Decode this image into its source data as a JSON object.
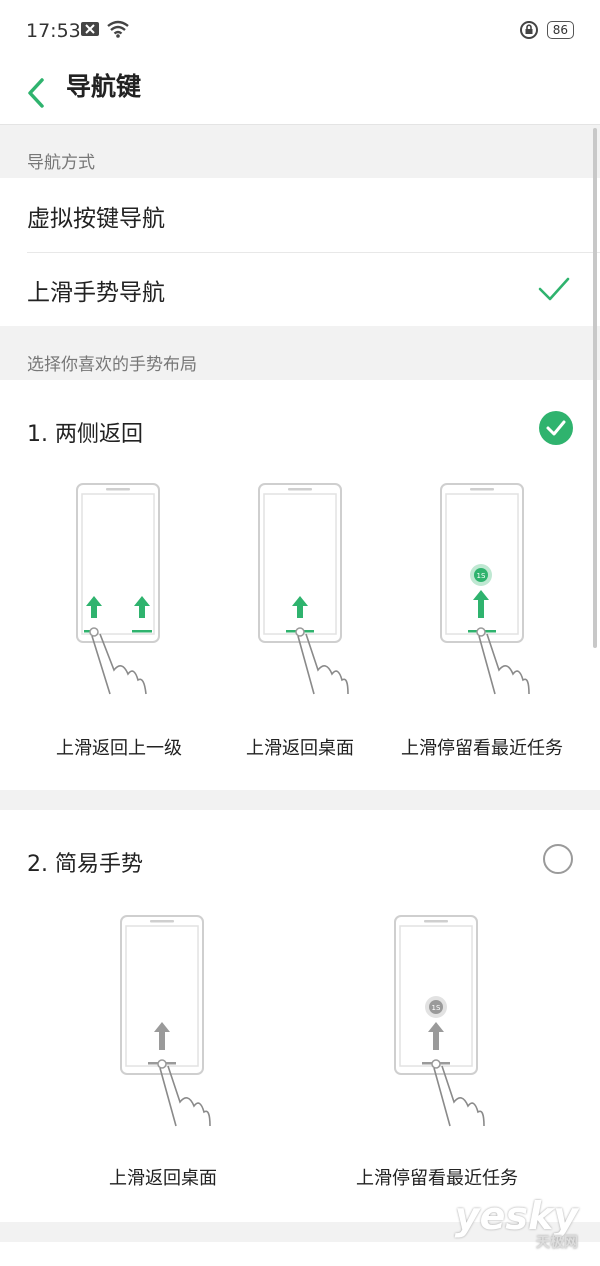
{
  "status": {
    "time": "17:53",
    "battery": "86"
  },
  "header": {
    "title": "导航键"
  },
  "nav_mode": {
    "section_label": "导航方式",
    "options": [
      {
        "label": "虚拟按键导航",
        "selected": false
      },
      {
        "label": "上滑手势导航",
        "selected": true
      }
    ]
  },
  "layouts": {
    "section_label": "选择你喜欢的手势布局",
    "items": [
      {
        "title": "1. 两侧返回",
        "selected": true,
        "captions": [
          "上滑返回上一级",
          "上滑返回桌面",
          "上滑停留看最近任务"
        ]
      },
      {
        "title": "2. 简易手势",
        "selected": false,
        "captions": [
          "上滑返回桌面",
          "上滑停留看最近任务"
        ]
      }
    ]
  },
  "colors": {
    "accent": "#2fb36e",
    "inactive": "#9a9a9a"
  },
  "illustration_badge": "1S",
  "watermark": {
    "brand": "yesky",
    "sub": "天极网"
  }
}
